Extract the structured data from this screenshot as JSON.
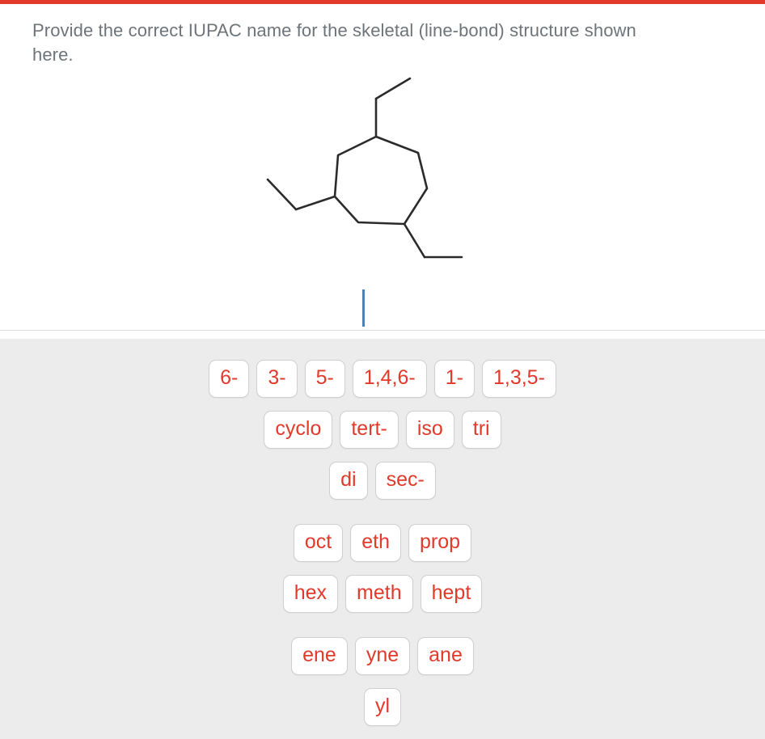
{
  "theme": {
    "accent_red": "#e1392a",
    "tile_text": "#e1392a",
    "question_text": "#6e7479",
    "tray_bg": "#ececec",
    "caret_color": "#4a82b8",
    "bond_color": "#2b2b2b"
  },
  "question": {
    "text": "Provide the correct IUPAC name for the skeletal (line-bond) structure shown here."
  },
  "structure": {
    "name": "skeletal-structure-cycloheptane-triethyl",
    "ring_label": "seven-membered ring",
    "substituents": "three ethyl groups"
  },
  "answer_zone": {
    "current_value": "",
    "caret_visible": true
  },
  "tile_rows": [
    {
      "row_name": "locants",
      "tiles": [
        {
          "label": "6-"
        },
        {
          "label": "3-"
        },
        {
          "label": "5-"
        },
        {
          "label": "1,4,6-"
        },
        {
          "label": "1-"
        },
        {
          "label": "1,3,5-"
        }
      ]
    },
    {
      "row_name": "prefixes",
      "tiles": [
        {
          "label": "cyclo"
        },
        {
          "label": "tert-"
        },
        {
          "label": "iso"
        },
        {
          "label": "tri"
        }
      ]
    },
    {
      "row_name": "multipliers",
      "tiles": [
        {
          "label": "di"
        },
        {
          "label": "sec-"
        }
      ]
    },
    {
      "row_name": "stems-upper",
      "tiles": [
        {
          "label": "oct"
        },
        {
          "label": "eth"
        },
        {
          "label": "prop"
        }
      ]
    },
    {
      "row_name": "stems-lower",
      "tiles": [
        {
          "label": "hex"
        },
        {
          "label": "meth"
        },
        {
          "label": "hept"
        }
      ]
    },
    {
      "row_name": "suffixes",
      "tiles": [
        {
          "label": "ene"
        },
        {
          "label": "yne"
        },
        {
          "label": "ane"
        }
      ]
    },
    {
      "row_name": "suffix-yl",
      "tiles": [
        {
          "label": "yl"
        }
      ]
    }
  ]
}
